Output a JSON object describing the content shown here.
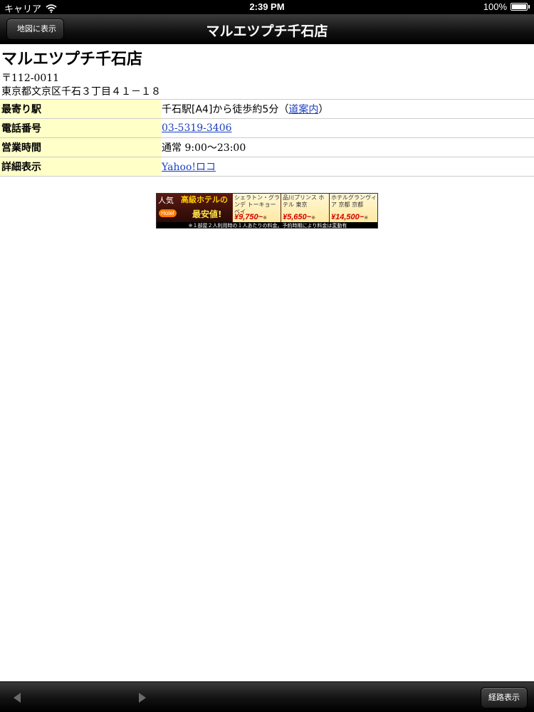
{
  "status_bar": {
    "carrier": "キャリア",
    "time": "2:39 PM",
    "battery": "100%"
  },
  "nav": {
    "back_label": "地図に表示",
    "title": "マルエツプチ千石店"
  },
  "shop": {
    "name": "マルエツプチ千石店",
    "postal": "〒112-0011",
    "address": "東京都文京区千石３丁目４１－１８"
  },
  "info_rows": {
    "station": {
      "label": "最寄り駅",
      "text": "千石駅[A4]から徒歩約5分（",
      "link": "道案内",
      "after": "）"
    },
    "phone": {
      "label": "電話番号",
      "value": "03-5319-3406"
    },
    "hours": {
      "label": "営業時間",
      "value": "通常 9:00〜23:00"
    },
    "details": {
      "label": "詳細表示",
      "link": "Yahoo!ロコ"
    }
  },
  "banner": {
    "headline_1": "人気",
    "headline_2": "高級ホテルの",
    "headline_3": "最安値!",
    "logo": "Hotel",
    "hotels": [
      {
        "name": "シェラトン・グランデ トーキョーベイ",
        "price": "¥9,750~",
        "mark": "※"
      },
      {
        "name": "品川プリンス ホテル 東京",
        "price": "¥5,650~",
        "mark": "※"
      },
      {
        "name": "ホテルグランヴィア 京都 京都",
        "price": "¥14,500~",
        "mark": "※"
      }
    ],
    "footnote": "※１部屋２人利用時の１人あたりの料金。予約時期により料金は変動有"
  },
  "toolbar": {
    "route_label": "経路表示"
  },
  "colors": {
    "label_bg": "#ffffc8",
    "link": "#1a3fbf"
  }
}
